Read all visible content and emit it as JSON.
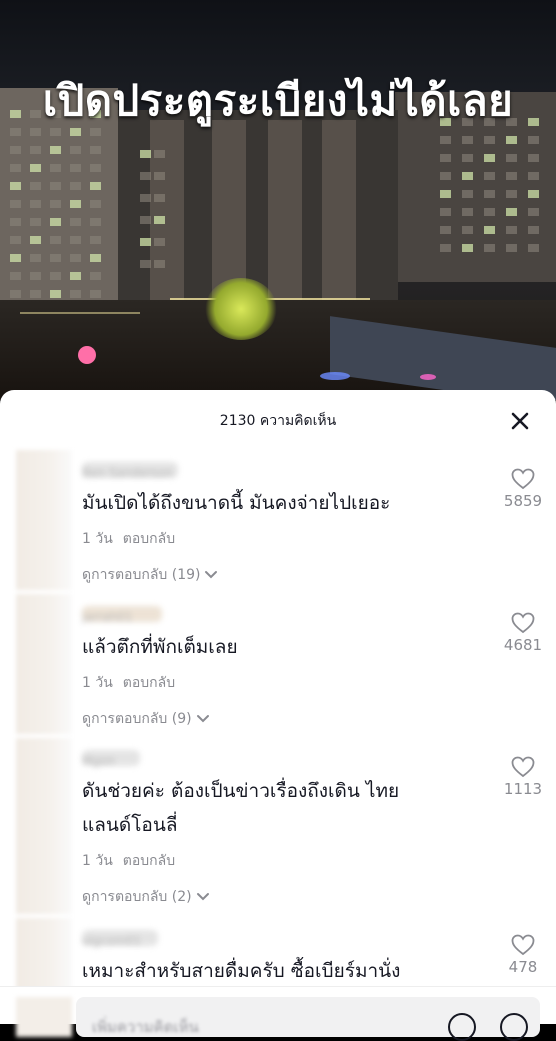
{
  "video": {
    "caption": "เปิดประตูระเบียงไม่ได้เลย"
  },
  "sheet": {
    "title": "2130 ความคิดเห็น",
    "close_icon": "close-icon"
  },
  "comments": [
    {
      "username": "Ben Sanderson",
      "text_lines": [
        "มันเปิดได้ถึงขนาดนี้ มันคงจ่ายไปเยอะ"
      ],
      "time": "1 วัน",
      "reply_label": "ตอบกลับ",
      "view_replies": "ดูการตอบกลับ (19)",
      "likes": "5859"
    },
    {
      "username": "jarrah01",
      "text_lines": [
        "แล้วตึกที่พักเต็มเลย"
      ],
      "time": "1 วัน",
      "reply_label": "ตอบกลับ",
      "view_replies": "ดูการตอบกลับ (9)",
      "likes": "4681"
    },
    {
      "username": "Mgon",
      "text_lines": [
        "ดันช่วยค่ะ ต้องเป็นข่าวเรื่องถึงเดิน ไทย",
        "แลนด์โอนลี่"
      ],
      "time": "1 วัน",
      "reply_label": "ตอบกลับ",
      "view_replies": "ดูการตอบกลับ (2)",
      "likes": "1113"
    },
    {
      "username": "olgcom01",
      "text_lines": [
        "เหมาะสำหรับสายดื่มครับ ซื้อเบียร์มานั่ง"
      ],
      "likes": "478"
    }
  ],
  "input": {
    "placeholder": "เพิ่มความคิดเห็น",
    "mention_icon": "at-icon",
    "emoji_icon": "emoji-icon"
  },
  "icons": {
    "like": "heart-outline-icon",
    "expand": "chevron-down-icon"
  },
  "colors": {
    "text_primary": "#161823",
    "text_secondary": "#8a8b91"
  }
}
